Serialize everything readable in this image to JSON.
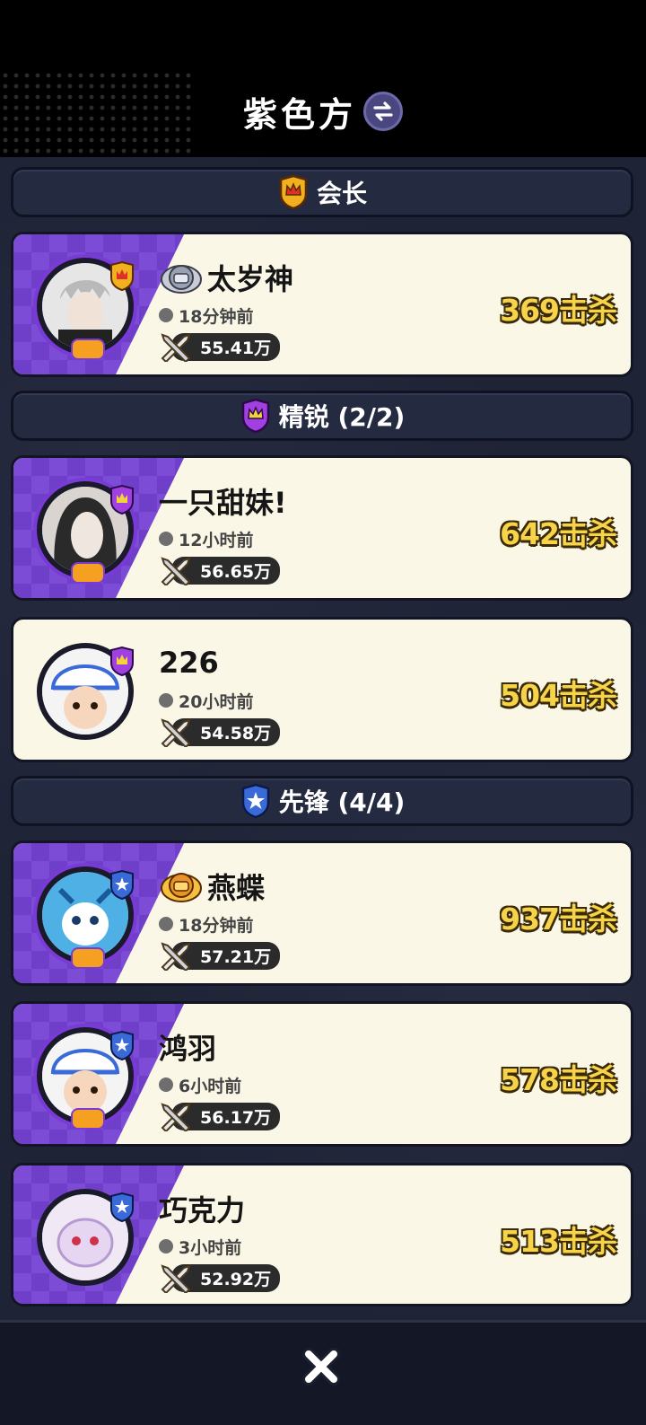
{
  "header": {
    "title": "紫色方"
  },
  "sections": [
    {
      "label": "会长",
      "members": [
        {
          "name": "太岁神",
          "time": "18分钟前",
          "power": "55.41万",
          "kills": "369击杀",
          "title_icon": "helmet-badge-icon",
          "rank": "leader"
        }
      ]
    },
    {
      "label": "精锐 (2/2)",
      "members": [
        {
          "name": "一只甜妹!",
          "time": "12小时前",
          "power": "56.65万",
          "kills": "642击杀",
          "rank": "elite"
        },
        {
          "name": "226",
          "time": "20小时前",
          "power": "54.58万",
          "kills": "504击杀",
          "rank": "elite"
        }
      ]
    },
    {
      "label": "先锋 (4/4)",
      "members": [
        {
          "name": "燕蝶",
          "time": "18分钟前",
          "power": "57.21万",
          "kills": "937击杀",
          "title_icon": "gold-helmet-badge-icon",
          "rank": "vanguard"
        },
        {
          "name": "鸿羽",
          "time": "6小时前",
          "power": "56.17万",
          "kills": "578击杀",
          "rank": "vanguard"
        },
        {
          "name": "巧克力",
          "time": "3小时前",
          "power": "52.92万",
          "kills": "513击杀",
          "rank": "vanguard"
        }
      ]
    }
  ],
  "colors": {
    "leader_badge": "#f0b020",
    "elite_badge": "#a040e0",
    "vanguard_badge": "#3a6ad8",
    "kills_text": "#f7d34a",
    "card_bg": "#fbf7e6",
    "purple_band": "#7c4cd6"
  }
}
